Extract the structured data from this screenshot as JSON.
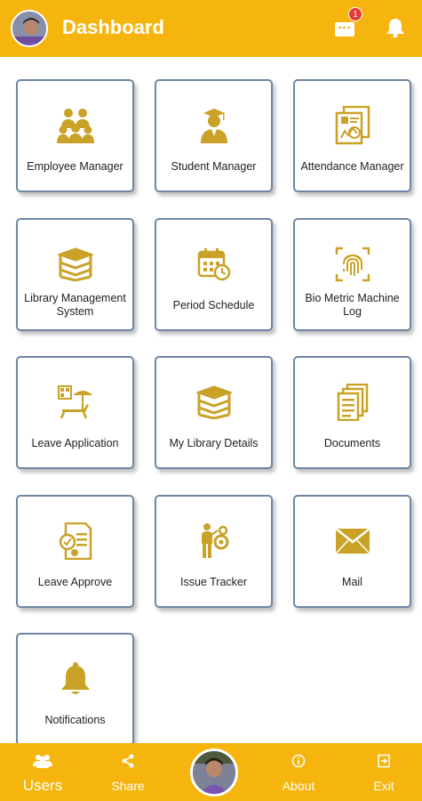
{
  "header": {
    "title": "Dashboard",
    "mail_badge": "1"
  },
  "tiles": [
    {
      "label_lines": [
        "Employee Manager"
      ],
      "icon": "employees-icon"
    },
    {
      "label_lines": [
        "Student Manager"
      ],
      "icon": "graduate-icon"
    },
    {
      "label_lines": [
        "Attendance Manager"
      ],
      "icon": "attendance-icon"
    },
    {
      "label_lines": [
        "Library Management",
        "System"
      ],
      "icon": "books-icon"
    },
    {
      "label_lines": [
        "Period Schedule"
      ],
      "icon": "calendar-clock-icon"
    },
    {
      "label_lines": [
        "Bio Metric Machine",
        "Log"
      ],
      "icon": "fingerprint-icon"
    },
    {
      "label_lines": [
        "Leave Application"
      ],
      "icon": "beach-chair-icon"
    },
    {
      "label_lines": [
        "My Library Details"
      ],
      "icon": "book-stack-icon"
    },
    {
      "label_lines": [
        "Documents"
      ],
      "icon": "documents-icon"
    },
    {
      "label_lines": [
        "Leave Approve"
      ],
      "icon": "approve-document-icon"
    },
    {
      "label_lines": [
        "Issue Tracker"
      ],
      "icon": "issue-tracker-icon"
    },
    {
      "label_lines": [
        "Mail"
      ],
      "icon": "envelope-icon"
    },
    {
      "label_lines": [
        "Notifications"
      ],
      "icon": "bell-icon"
    }
  ],
  "bottom_nav": {
    "users": "Users",
    "share": "Share",
    "about": "About",
    "exit": "Exit"
  },
  "colors": {
    "accent": "#F5B50E",
    "icon_gold": "#C9A227",
    "tile_border": "#6E86A3"
  }
}
